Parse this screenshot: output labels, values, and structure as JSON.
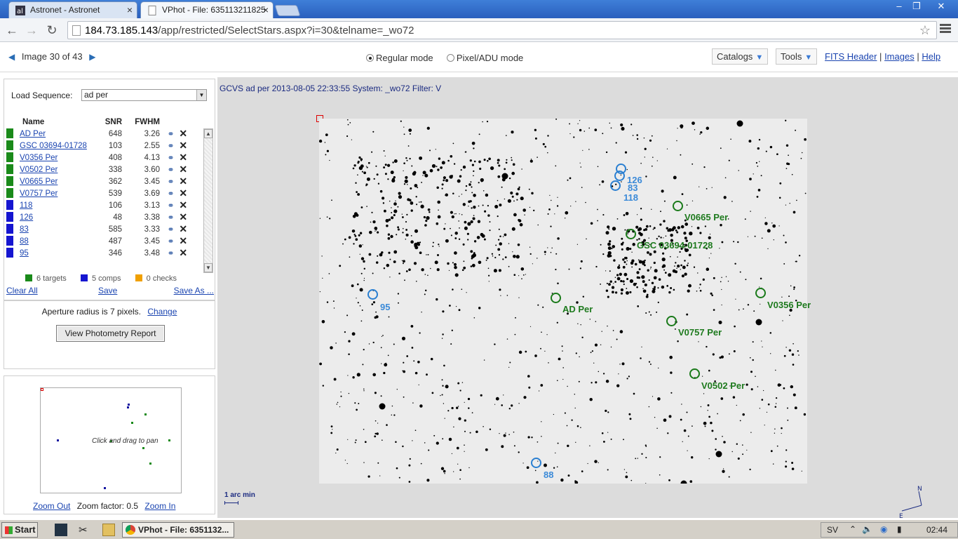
{
  "browser": {
    "tabs": [
      {
        "label": "Astronet - Astronet"
      },
      {
        "label": "VPhot - File: 635113211825"
      }
    ],
    "url_host": "184.73.185.143",
    "url_path": "/app/restricted/SelectStars.aspx?i=30&telname=_wo72"
  },
  "header": {
    "image_counter": "Image 30 of 43",
    "mode_regular": "Regular mode",
    "mode_pixel": "Pixel/ADU mode",
    "catalogs": "Catalogs",
    "tools": "Tools",
    "fits_header": "FITS Header",
    "images": "Images",
    "help": "Help",
    "sep": "|"
  },
  "sequence": {
    "label": "Load Sequence:",
    "selected": "ad per"
  },
  "table": {
    "headers": {
      "name": "Name",
      "snr": "SNR",
      "fwhm": "FWHM"
    },
    "rows": [
      {
        "name": "AD Per",
        "snr": "648",
        "fwhm": "3.26",
        "kind": "target"
      },
      {
        "name": "GSC 03694-01728",
        "snr": "103",
        "fwhm": "2.55",
        "kind": "target"
      },
      {
        "name": "V0356 Per",
        "snr": "408",
        "fwhm": "4.13",
        "kind": "target"
      },
      {
        "name": "V0502 Per",
        "snr": "338",
        "fwhm": "3.60",
        "kind": "target"
      },
      {
        "name": "V0665 Per",
        "snr": "362",
        "fwhm": "3.45",
        "kind": "target"
      },
      {
        "name": "V0757 Per",
        "snr": "539",
        "fwhm": "3.69",
        "kind": "target"
      },
      {
        "name": "118",
        "snr": "106",
        "fwhm": "3.13",
        "kind": "comp"
      },
      {
        "name": "126",
        "snr": "48",
        "fwhm": "3.38",
        "kind": "comp"
      },
      {
        "name": "83",
        "snr": "585",
        "fwhm": "3.33",
        "kind": "comp"
      },
      {
        "name": "88",
        "snr": "487",
        "fwhm": "3.45",
        "kind": "comp"
      },
      {
        "name": "95",
        "snr": "346",
        "fwhm": "3.48",
        "kind": "comp"
      }
    ]
  },
  "legend": {
    "targets": "6 targets",
    "comps": "5 comps",
    "checks": "0 checks"
  },
  "colors": {
    "target": "#1a8a1a",
    "comp": "#1515d0",
    "check": "#f0a000",
    "label_target": "#1e7a1e",
    "label_comp": "#3b8ad8"
  },
  "actions": {
    "clear_all": "Clear All",
    "save": "Save",
    "save_as": "Save As ..."
  },
  "aperture": {
    "text": "Aperture radius is 7 pixels.",
    "change": "Change",
    "report_button": "View Photometry Report"
  },
  "navigator": {
    "hint": "Click and drag to pan",
    "zoom_out": "Zoom Out",
    "zoom_factor": "Zoom factor: 0.5",
    "zoom_in": "Zoom In"
  },
  "image": {
    "caption": "GCVS ad per 2013-08-05 22:33:55 System: _wo72 Filter: V",
    "scale_label": "1 arc min",
    "compass_n": "N",
    "compass_e": "E",
    "labels": {
      "ad_per": "AD Per",
      "gsc": "GSC 03694-01728",
      "v0356": "V0356 Per",
      "v0502": "V0502 Per",
      "v0665": "V0665 Per",
      "v0757": "V0757 Per",
      "c118": "118",
      "c126": "126",
      "c83": "83",
      "c88": "88",
      "c95": "95"
    }
  },
  "taskbar": {
    "start": "Start",
    "task_vphot": "VPhot - File: 6351132...",
    "lang": "SV",
    "clock": "02:44"
  }
}
